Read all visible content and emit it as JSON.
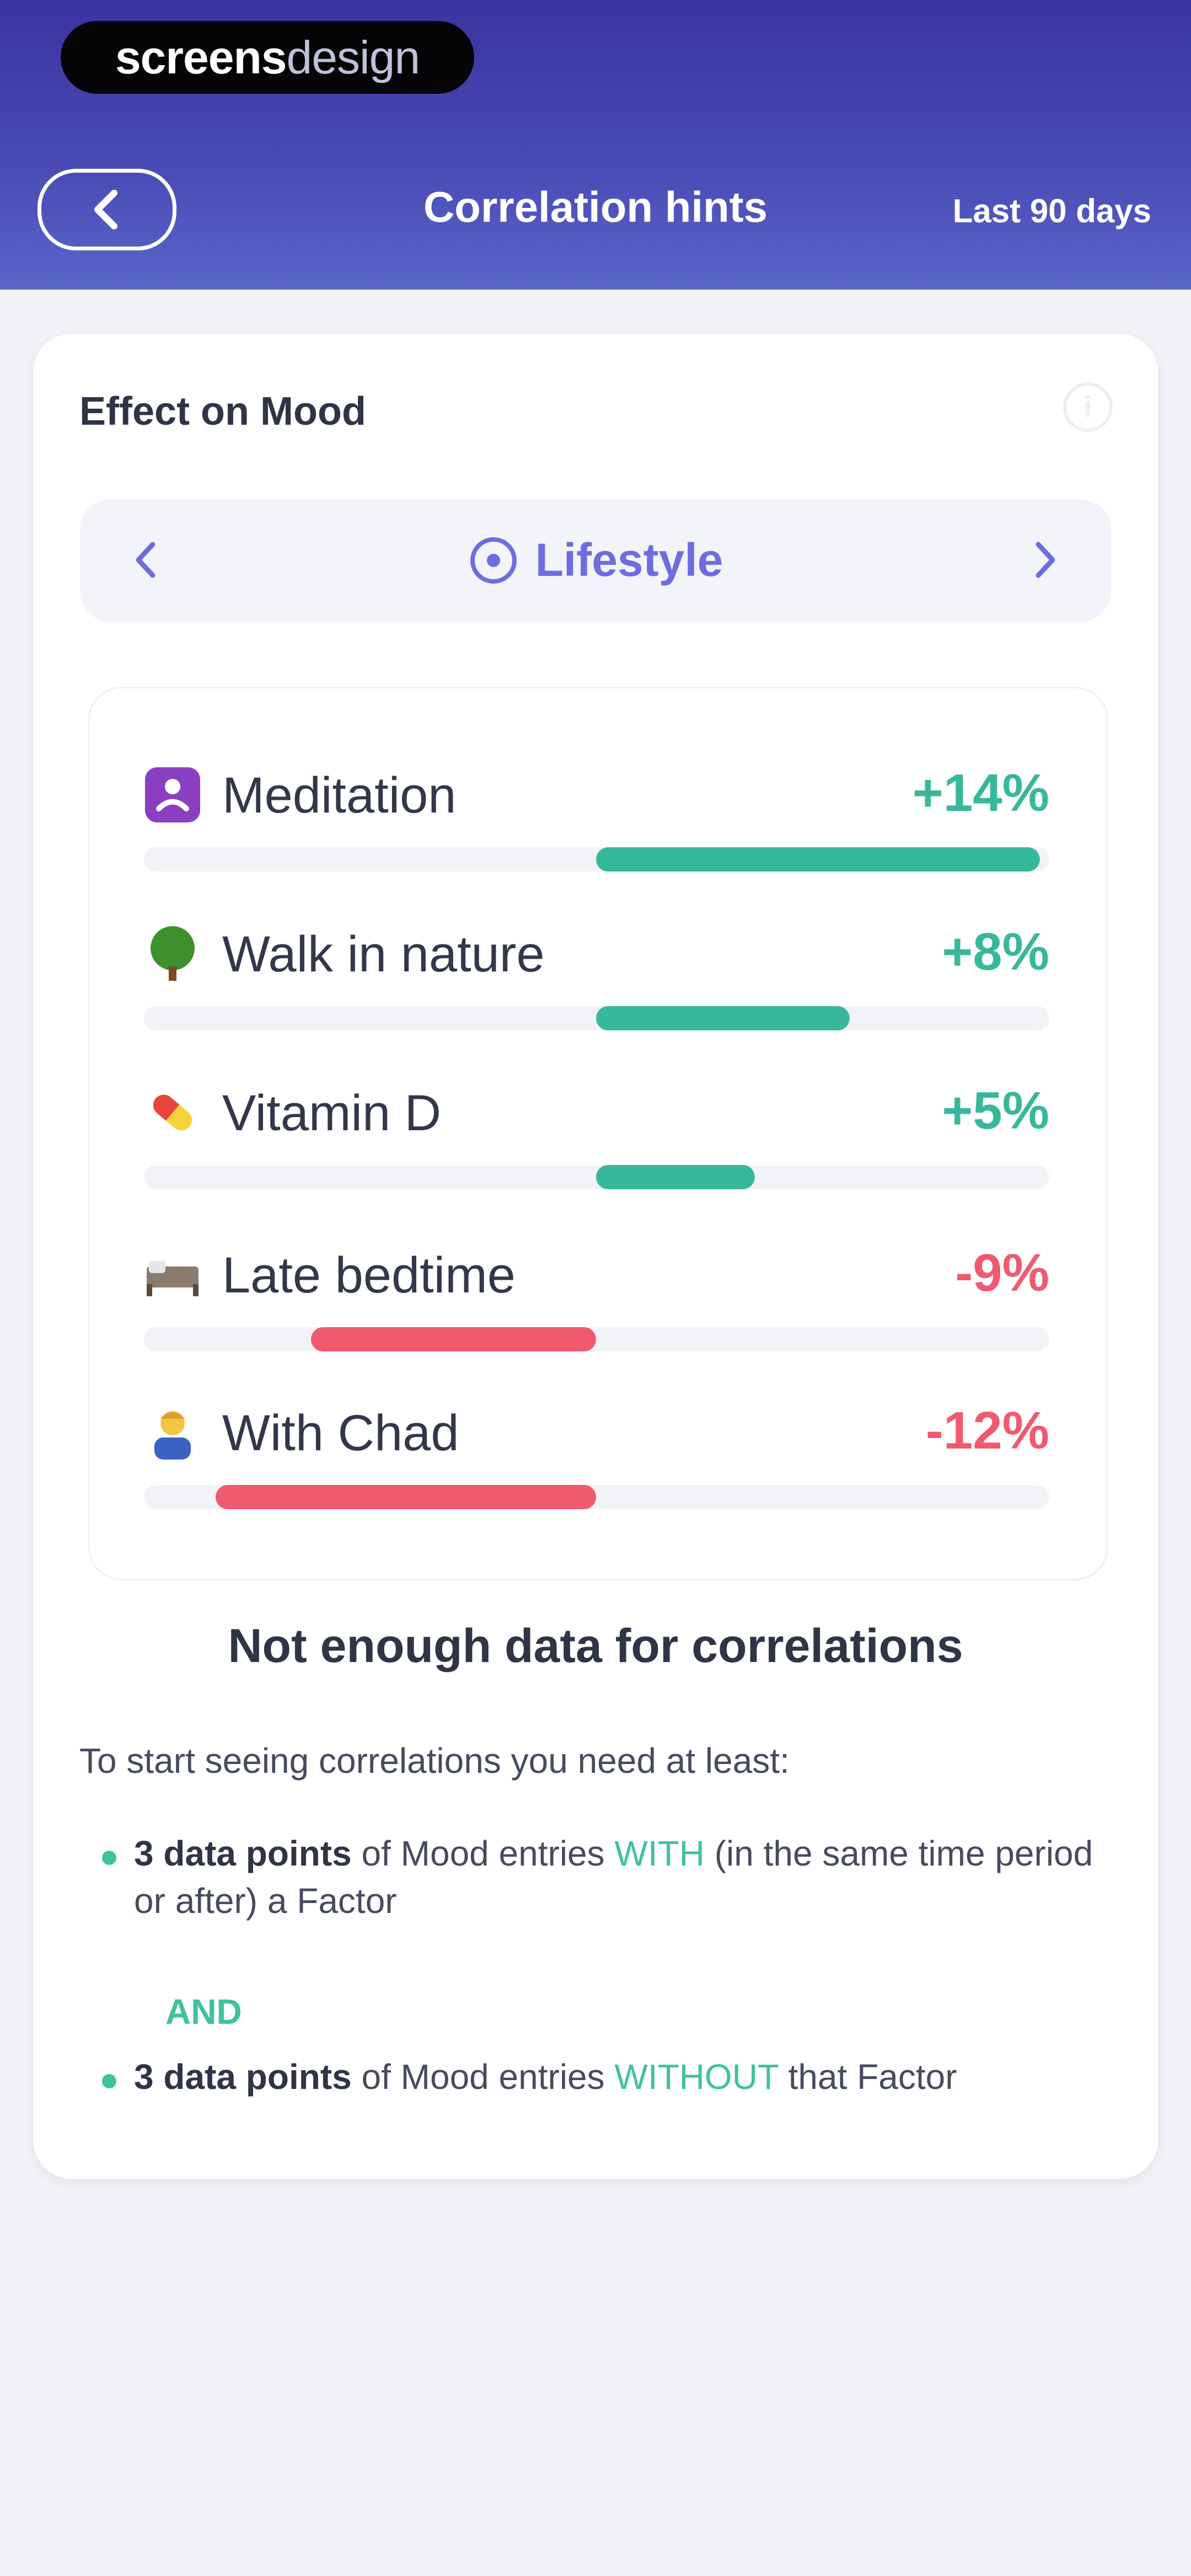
{
  "logo": {
    "part1": "screens",
    "part2": "design"
  },
  "header": {
    "title": "Correlation hints",
    "range": "Last 90 days",
    "back_icon": "chevron-left-icon"
  },
  "card": {
    "title": "Effect on Mood",
    "info_icon": "info-icon"
  },
  "category": {
    "label": "Lifestyle",
    "prev_icon": "chevron-left-icon",
    "next_icon": "chevron-right-icon",
    "accent": "#6d6ce0"
  },
  "factors": [
    {
      "name": "Meditation",
      "value": "+14%",
      "percent": 14,
      "icon": "meditation-icon"
    },
    {
      "name": "Walk in nature",
      "value": "+8%",
      "percent": 8,
      "icon": "tree-icon"
    },
    {
      "name": "Vitamin D",
      "value": "+5%",
      "percent": 5,
      "icon": "pill-icon"
    },
    {
      "name": "Late bedtime",
      "value": "-9%",
      "percent": -9,
      "icon": "bed-icon"
    },
    {
      "name": "With Chad",
      "value": "-12%",
      "percent": -12,
      "icon": "person-icon"
    }
  ],
  "colors": {
    "positive": "#38b89a",
    "negative": "#ef5a6f",
    "header": "#3a33a0"
  },
  "empty": {
    "title": "Not enough data for correlations",
    "intro": "To start seeing correlations you need at least:",
    "req1": {
      "bold": "3 data points",
      "mid": " of Mood entries ",
      "hl": "WITH",
      "rest": " (in the same time period or after) a Factor"
    },
    "and": "AND",
    "req2": {
      "bold": "3 data points",
      "mid": " of Mood entries ",
      "hl": "WITHOUT",
      "rest": " that Factor"
    }
  }
}
